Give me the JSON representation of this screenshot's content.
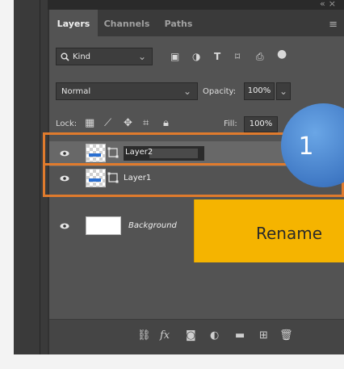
{
  "panel": {
    "tabs": [
      "Layers",
      "Channels",
      "Paths"
    ],
    "active_tab": "Layers",
    "menu_icon": "panel-menu-icon",
    "collapse_icon": "collapse-icon",
    "close_icon": "close-icon"
  },
  "filter": {
    "kind_label": "Kind",
    "kind_icon": "search-icon",
    "icons": [
      "pixel-filter-icon",
      "adjustment-filter-icon",
      "type-filter-icon",
      "shape-filter-icon",
      "smart-object-filter-icon",
      "filter-toggle-icon"
    ]
  },
  "blend": {
    "mode": "Normal",
    "opacity_label": "Opacity:",
    "opacity_value": "100%"
  },
  "lock": {
    "label": "Lock:",
    "icons": [
      "lock-transparent-icon",
      "lock-pixels-icon",
      "lock-position-icon",
      "lock-artboard-icon",
      "lock-all-icon"
    ],
    "fill_label": "Fill:",
    "fill_value": "100%"
  },
  "layers": [
    {
      "name": "Layer2",
      "selected": true,
      "renaming": true,
      "thumb": "checker-blue",
      "smart": true
    },
    {
      "name": "Layer1",
      "selected": false,
      "renaming": false,
      "thumb": "checker-blue",
      "smart": true
    },
    {
      "name": "Background",
      "selected": false,
      "renaming": false,
      "thumb": "white",
      "smart": false
    }
  ],
  "annotation": {
    "badge_number": "1",
    "banner_text": "Rename",
    "badge_color": "#4a86d0",
    "banner_color": "#f5b400",
    "frame_color": "#e07b2d"
  },
  "bottom_icons": [
    "link-layers-icon",
    "fx-icon",
    "mask-icon",
    "adjustment-layer-icon",
    "group-folder-icon",
    "new-layer-icon",
    "trash-icon"
  ],
  "fx_label": "fx"
}
